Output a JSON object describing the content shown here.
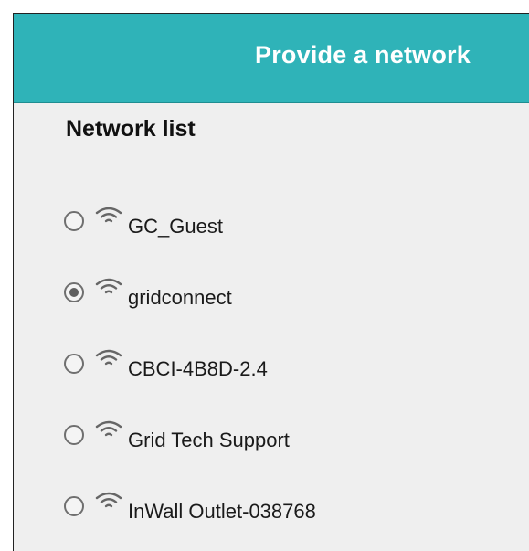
{
  "header": {
    "title": "Provide a network"
  },
  "network_list": {
    "title": "Network list",
    "wifi_icon": "wifi-icon",
    "items": [
      {
        "ssid": "GC_Guest",
        "selected": false
      },
      {
        "ssid": "gridconnect",
        "selected": true
      },
      {
        "ssid": "CBCI-4B8D-2.4",
        "selected": false
      },
      {
        "ssid": "Grid Tech Support",
        "selected": false
      },
      {
        "ssid": "InWall Outlet-038768",
        "selected": false
      }
    ]
  },
  "colors": {
    "header_bg": "#2fb3b8",
    "header_text": "#ffffff",
    "panel_bg": "#efefef",
    "radio": "#6f6f6f"
  }
}
